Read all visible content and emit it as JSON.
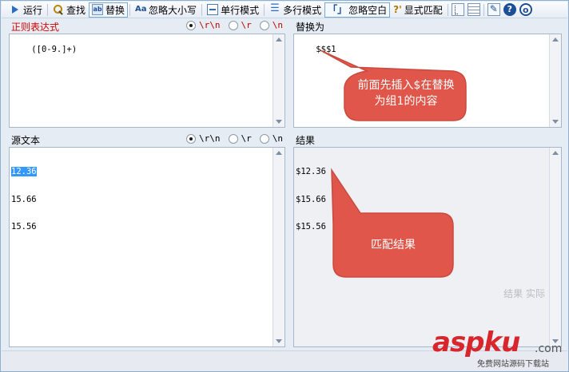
{
  "toolbar": {
    "run": "运行",
    "find": "查找",
    "replace": "替换",
    "ignore_case": "忽略大小写",
    "single_line": "单行模式",
    "multi_line": "多行模式",
    "ignore_ws": "忽略空白",
    "ignore_ws_icon_text": "「」",
    "show_match": "显式匹配",
    "show_match_icon_text": "?'"
  },
  "regex_panel": {
    "title": "正则表达式",
    "options": [
      "\\r\\n",
      "\\r",
      "\\n"
    ],
    "selected": "\\r\\n",
    "value": "([0-9.]+)"
  },
  "replace_panel": {
    "title": "替换为",
    "value": "$$$1"
  },
  "source_panel": {
    "title": "源文本",
    "options": [
      "\\r\\n",
      "\\r",
      "\\n"
    ],
    "selected": "\\r\\n",
    "lines": [
      "12.36",
      "15.66",
      "15.56"
    ]
  },
  "result_panel": {
    "title": "结果",
    "lines": [
      "$12.36",
      "$15.66",
      "$15.56"
    ],
    "faint_overlay": "结果 实际"
  },
  "callouts": {
    "top": [
      "前面先插入$在替换",
      "为组1的内容"
    ],
    "bottom": "匹配结果"
  },
  "watermark": {
    "brand": "aspku",
    "suffix": ".com",
    "sub": "免费网站源码下载站"
  },
  "colors": {
    "callout_fill": "#e0564a",
    "callout_stroke": "#c94a3f",
    "accent_blue": "#1d4f96",
    "title_red": "#d40000",
    "watermark_red": "#d8262c"
  },
  "icons": {
    "run": "play-icon",
    "find": "magnifier-icon",
    "replace": "replace-icon",
    "ignore_case": "case-icon",
    "single_line": "single-line-icon",
    "multi_line": "multi-line-icon",
    "tree": "tree-icon",
    "grid": "grid-icon",
    "edit": "edit-icon",
    "help": "help-icon",
    "info": "info-icon"
  }
}
